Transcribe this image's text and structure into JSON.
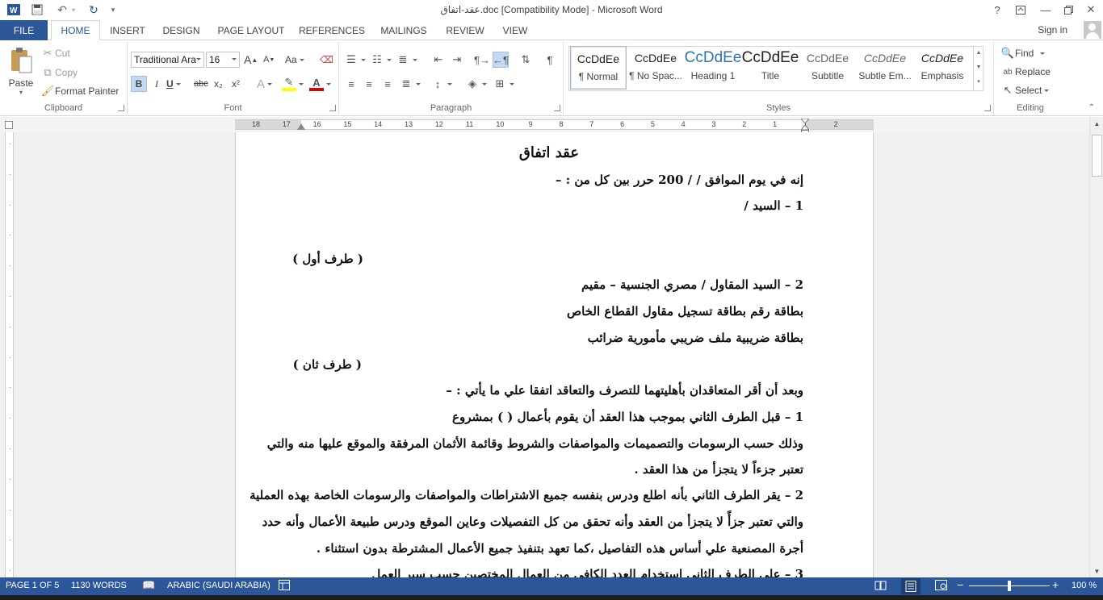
{
  "window": {
    "title": "عقد-اتفاق.doc [Compatibility Mode] - Microsoft Word",
    "help": "?",
    "sign_in": "Sign in"
  },
  "tabs": [
    "FILE",
    "HOME",
    "INSERT",
    "DESIGN",
    "PAGE LAYOUT",
    "REFERENCES",
    "MAILINGS",
    "REVIEW",
    "VIEW"
  ],
  "clipboard": {
    "paste": "Paste",
    "cut": "Cut",
    "copy": "Copy",
    "format_painter": "Format Painter",
    "label": "Clipboard"
  },
  "font": {
    "name": "Traditional Ara",
    "size": "16",
    "label": "Font",
    "bold": "B",
    "italic": "I",
    "underline": "U",
    "strike": "abc",
    "sub": "x₂",
    "sup": "x²",
    "grow": "A",
    "shrink": "A",
    "case": "Aa"
  },
  "paragraph": {
    "label": "Paragraph"
  },
  "styles": {
    "label": "Styles",
    "items": [
      {
        "preview": "CcDdEe",
        "name": "¶ Normal"
      },
      {
        "preview": "CcDdEe",
        "name": "¶ No Spac..."
      },
      {
        "preview": "CcDdEe",
        "name": "Heading 1"
      },
      {
        "preview": "CcDdEe",
        "name": "Title"
      },
      {
        "preview": "CcDdEe",
        "name": "Subtitle"
      },
      {
        "preview": "CcDdEe",
        "name": "Subtle Em..."
      },
      {
        "preview": "CcDdEe",
        "name": "Emphasis"
      }
    ]
  },
  "editing": {
    "find": "Find",
    "replace": "Replace",
    "select": "Select",
    "label": "Editing"
  },
  "ruler": {
    "ticks": [
      "18",
      "17",
      "16",
      "15",
      "14",
      "13",
      "12",
      "11",
      "10",
      "9",
      "8",
      "7",
      "6",
      "5",
      "4",
      "3",
      "2",
      "1",
      "1",
      "2"
    ]
  },
  "document": {
    "lines": [
      "عقد اتفاق",
      "إنه في يوم          الموافق      /     /  200 حرر بين كل من : –",
      "1 – السيد /",
      "( طرف أول )",
      "2 – السيد المقاول /             مصري الجنسية –  مقيم",
      "بطاقة رقم               بطاقة تسجيل مقاول القطاع الخاص",
      "بطاقة ضريبية                 ملف ضريبي              مأمورية ضرائب",
      "( طرف ثان )",
      "وبعد أن أقر المتعاقدان بأهليتهما للتصرف والتعاقد اتفقا علي ما يأتي : –",
      "1 –  قبل الطرف الثاني بموجب هذا العقد أن يقوم بأعمال (                              ) بمشروع",
      "وذلك حسب الرسومات والتصميمات والمواصفات والشروط وقائمة الأثمان المرفقة والموقع عليها منه والتي",
      "تعتبر جزءاً لا يتجزأ من هذا العقد .",
      "2 –  يقر الطرف الثاني بأنه اطلع ودرس بنفسه جميع الاشتراطات والمواصفات والرسومات الخاصة بهذه العملية",
      "والتي تعتبر جزأً لا يتجزأ من العقد وأنه تحقق من كل التفصيلات وعاين الموقع ودرس طبيعة الأعمال وأنه حدد",
      "أجرة المصنعية علي أساس هذه التفاصيل ،كما تعهد بتنفيذ جميع الأعمال المشترطة بدون استثناء .",
      "3 –  علي الطرف الثاني استخدام العدد الكافي من العمال المختصين حسب سير العمل"
    ]
  },
  "status": {
    "page": "PAGE 1 OF 5",
    "words": "1130 WORDS",
    "language": "ARABIC (SAUDI ARABIA)",
    "zoom": "100 %",
    "zoom_percent": 100
  }
}
